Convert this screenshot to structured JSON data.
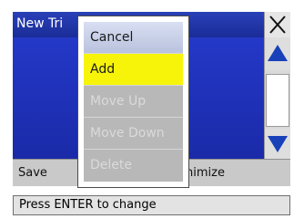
{
  "window": {
    "title": "New Tri",
    "close_icon": "close-icon"
  },
  "scrollbar": {
    "up_icon": "triangle-up-icon",
    "down_icon": "triangle-down-icon"
  },
  "bottom_bar": {
    "save_label": "Save",
    "optimize_label": "nimize"
  },
  "status": {
    "text": "Press ENTER to change"
  },
  "popup_menu": {
    "items": [
      {
        "label": "Cancel",
        "state": "enabled"
      },
      {
        "label": "Add",
        "state": "highlighted"
      },
      {
        "label": "Move Up",
        "state": "disabled"
      },
      {
        "label": "Move Down",
        "state": "disabled"
      },
      {
        "label": "Delete",
        "state": "disabled"
      }
    ]
  },
  "colors": {
    "title_blue": "#1a2c98",
    "list_blue": "#2438c8",
    "highlight_yellow": "#f7f40a",
    "arrow_blue": "#1840b8",
    "menu_gray": "#b8b8b8"
  }
}
